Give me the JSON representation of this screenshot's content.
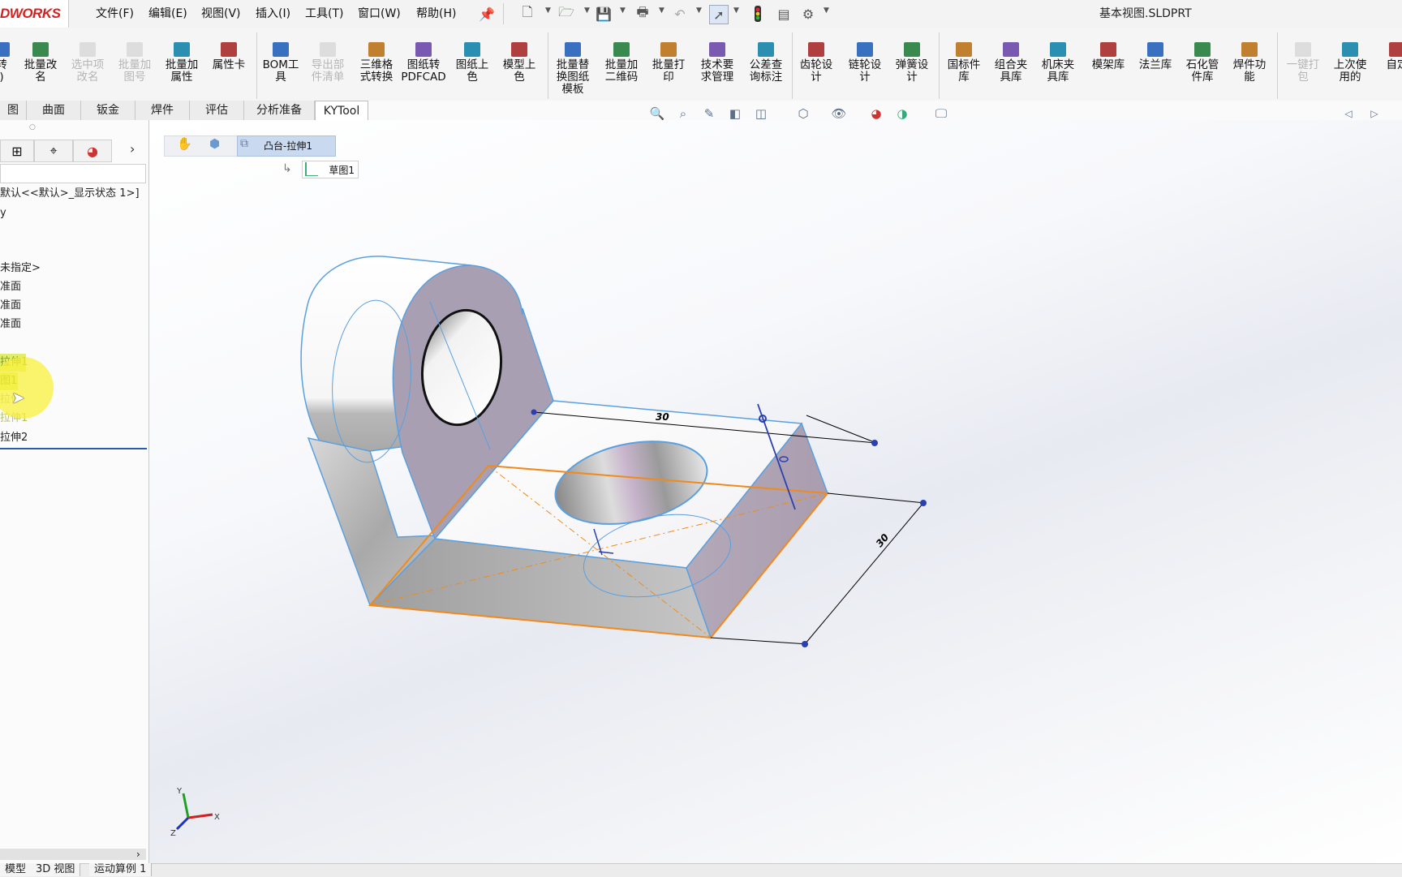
{
  "app": {
    "logo": "DWORKS",
    "title": "基本视图.SLDPRT",
    "menus": [
      "文件(F)",
      "编辑(E)",
      "视图(V)",
      "插入(I)",
      "工具(T)",
      "窗口(W)",
      "帮助(H)"
    ]
  },
  "ribbon": {
    "tools": [
      {
        "label": "转\n)"
      },
      {
        "label": "批量改\n名"
      },
      {
        "label": "选中项\n改名",
        "disabled": true
      },
      {
        "label": "批量加\n图号",
        "disabled": true
      },
      {
        "label": "批量加\n属性"
      },
      {
        "label": "属性卡"
      },
      {
        "label": "BOM工\n具"
      },
      {
        "label": "导出部\n件清单",
        "disabled": true
      },
      {
        "label": "三维格\n式转换"
      },
      {
        "label": "图纸转\nPDFCAD"
      },
      {
        "label": "图纸上\n色"
      },
      {
        "label": "模型上\n色"
      },
      {
        "label": "批量替\n换图纸\n模板"
      },
      {
        "label": "批量加\n二维码"
      },
      {
        "label": "批量打\n印"
      },
      {
        "label": "技术要\n求管理"
      },
      {
        "label": "公差查\n询标注"
      },
      {
        "label": "齿轮设\n计"
      },
      {
        "label": "链轮设\n计"
      },
      {
        "label": "弹簧设\n计"
      },
      {
        "label": "国标件\n库"
      },
      {
        "label": "组合夹\n具库"
      },
      {
        "label": "机床夹\n具库"
      },
      {
        "label": "模架库"
      },
      {
        "label": "法兰库"
      },
      {
        "label": "石化管\n件库"
      },
      {
        "label": "焊件功\n能"
      },
      {
        "label": "一键打\n包",
        "disabled": true
      },
      {
        "label": "上次使\n用的"
      },
      {
        "label": "自定"
      }
    ]
  },
  "tabs": [
    "图",
    "曲面",
    "钣金",
    "焊件",
    "评估",
    "分析准备",
    "KYTool"
  ],
  "breadcrumb": {
    "feature": "凸台-拉伸1",
    "sketch": "草图1"
  },
  "tree": {
    "items": [
      "默认<<默认>_显示状态 1>]",
      "y",
      "未指定>",
      "准面",
      "准面",
      "准面",
      "拉伸1",
      "图1",
      "拉伸",
      "拉伸1",
      "拉伸2"
    ]
  },
  "dimensions": {
    "width": "30",
    "depth": "30"
  },
  "triad": {
    "x": "X",
    "y": "Y",
    "z": "Z"
  },
  "bottom_tabs": [
    "模型",
    "3D 视图",
    "运动算例 1"
  ]
}
